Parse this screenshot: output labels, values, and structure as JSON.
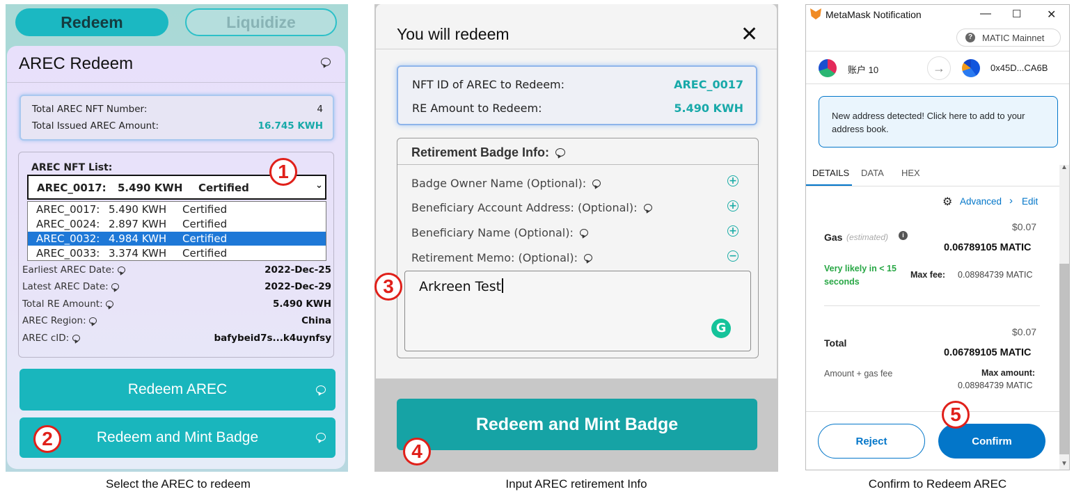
{
  "badges": [
    "1",
    "2",
    "3",
    "4",
    "5"
  ],
  "captions": {
    "panel1": "Select the AREC to redeem",
    "panel2": "Input AREC retirement Info",
    "panel3": "Confirm to Redeem AREC"
  },
  "panel1": {
    "tabs": {
      "redeem": "Redeem",
      "liquidize": "Liquidize"
    },
    "title": "AREC Redeem",
    "summary": {
      "nft_number_label": "Total AREC NFT Number:",
      "nft_number_value": "4",
      "issued_label": "Total Issued AREC Amount:",
      "issued_value": "16.745 KWH"
    },
    "list_label": "AREC NFT List:",
    "selected": {
      "id": "AREC_0017:",
      "amount": "5.490 KWH",
      "status": "Certified"
    },
    "options": [
      {
        "id": "AREC_0017:",
        "amount": "5.490 KWH",
        "status": "Certified"
      },
      {
        "id": "AREC_0024:",
        "amount": "2.897 KWH",
        "status": "Certified"
      },
      {
        "id": "AREC_0032:",
        "amount": "4.984 KWH",
        "status": "Certified"
      },
      {
        "id": "AREC_0033:",
        "amount": "3.374 KWH",
        "status": "Certified"
      }
    ],
    "details": [
      {
        "label": "Earliest AREC Date:",
        "value": "2022-Dec-25"
      },
      {
        "label": "Latest AREC Date:",
        "value": "2022-Dec-29"
      },
      {
        "label": "Total RE Amount:",
        "value": "5.490 KWH"
      },
      {
        "label": "AREC Region:",
        "value": "China"
      },
      {
        "label": "AREC cID:",
        "value": "bafybeid7s...k4uynfsy"
      }
    ],
    "btn_redeem": "Redeem AREC",
    "btn_redeem_mint": "Redeem and Mint Badge"
  },
  "panel2": {
    "title": "You will redeem",
    "close": "✕",
    "nft_id_label": "NFT ID of AREC to Redeem:",
    "nft_id_value": "AREC_0017",
    "re_amount_label": "RE Amount to Redeem:",
    "re_amount_value": "5.490 KWH",
    "badge_title": "Retirement Badge Info:",
    "fields": [
      {
        "label": "Badge Owner Name (Optional):",
        "toggle": "+"
      },
      {
        "label": "Beneficiary Account Address: (Optional):",
        "toggle": "+"
      },
      {
        "label": "Beneficiary Name (Optional):",
        "toggle": "+"
      },
      {
        "label": "Retirement Memo: (Optional):",
        "toggle": "−"
      }
    ],
    "memo_value": "Arkreen Test",
    "grammarly": "G",
    "btn": "Redeem and Mint Badge"
  },
  "panel3": {
    "window_title": "MetaMask Notification",
    "network": "MATIC Mainnet",
    "from_account": "账户 10",
    "to_address": "0x45D...CA6B",
    "notice": "New address detected! Click here to add to your address book.",
    "tabs": [
      "DETAILS",
      "DATA",
      "HEX"
    ],
    "advanced": "Advanced",
    "edit": "Edit",
    "gas_label": "Gas",
    "gas_estimated": "(estimated)",
    "gas_usd": "$0.07",
    "gas_matic": "0.06789105 MATIC",
    "likely": "Very likely in < 15 seconds",
    "max_fee_label": "Max fee:",
    "max_fee_value": "0.08984739 MATIC",
    "total_label": "Total",
    "total_usd": "$0.07",
    "total_matic": "0.06789105 MATIC",
    "amount_gas_label": "Amount + gas fee",
    "max_amount_label": "Max amount:",
    "max_amount_value": "0.08984739 MATIC",
    "btn_reject": "Reject",
    "btn_confirm": "Confirm"
  }
}
